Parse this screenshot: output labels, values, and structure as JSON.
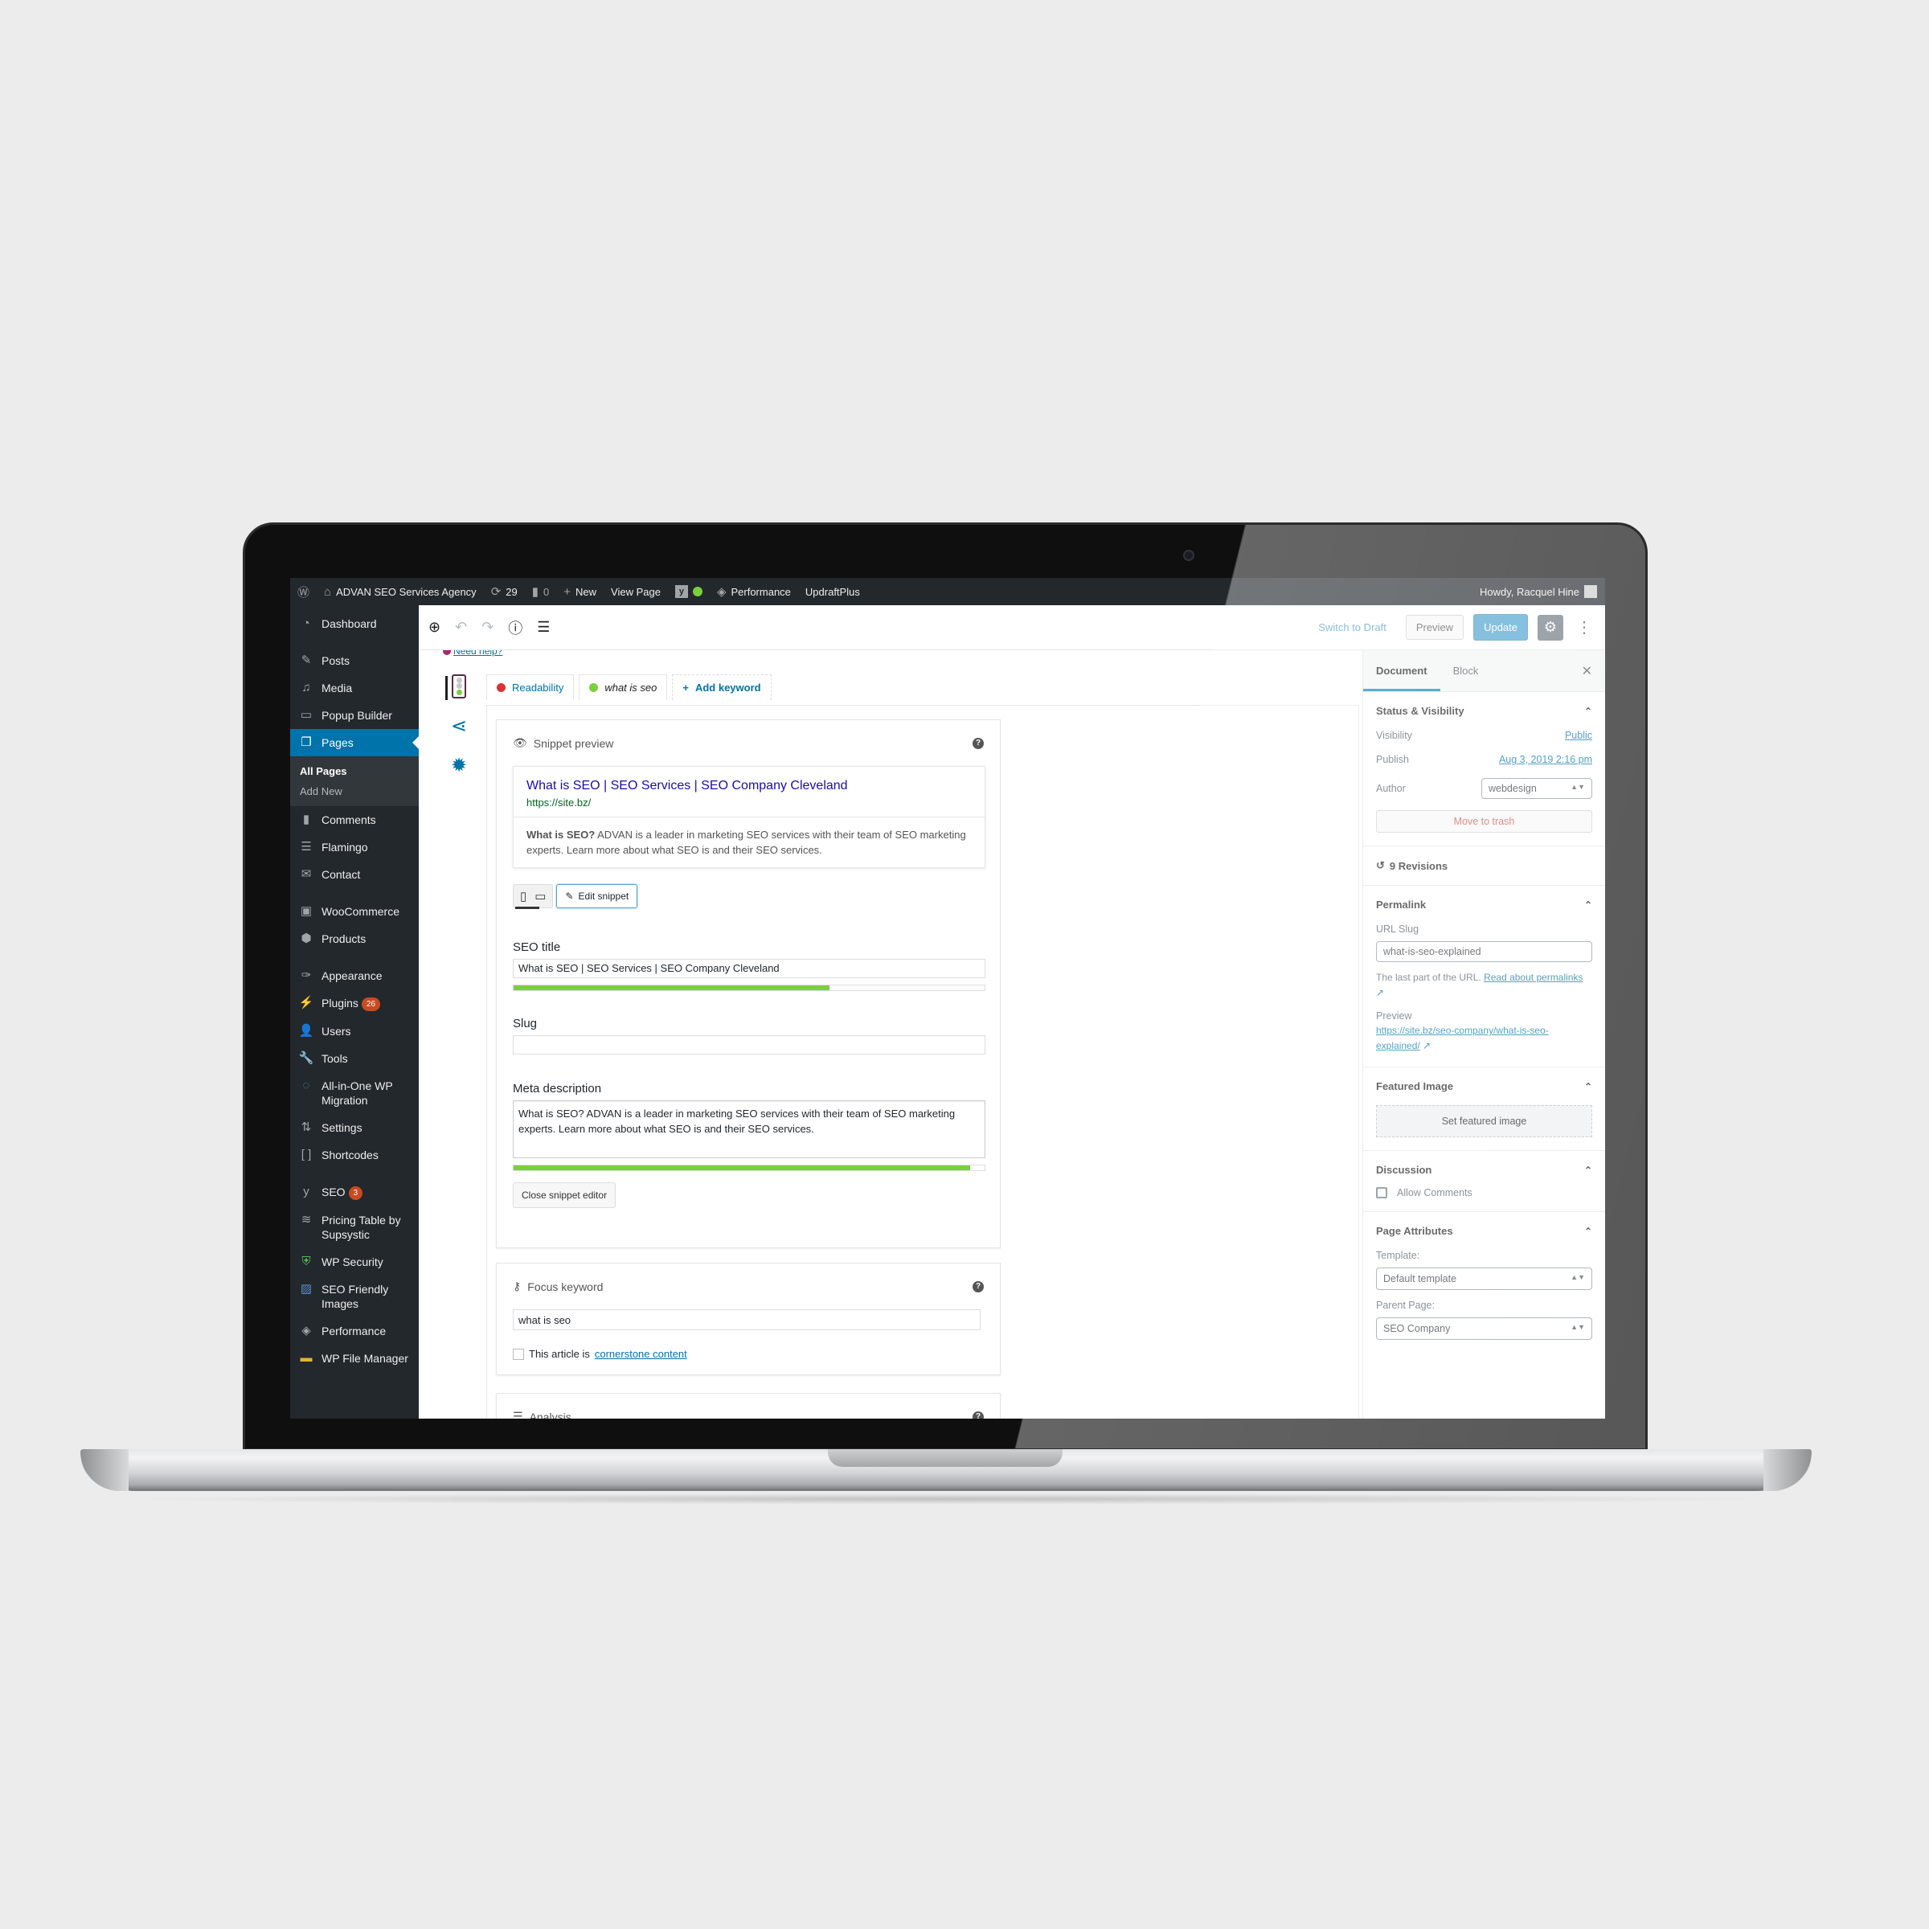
{
  "admin_bar": {
    "wp_logo": "wordpress-icon",
    "site_name": "ADVAN SEO Services Agency",
    "updates_count": "29",
    "comments_count": "0",
    "new_label": "New",
    "view_page_label": "View Page",
    "performance_label": "Performance",
    "updraft_label": "UpdraftPlus",
    "greeting": "Howdy, Racquel Hine"
  },
  "sidebar": {
    "items": [
      {
        "label": "Dashboard",
        "icon": "dashboard-icon"
      },
      {
        "label": "Posts",
        "icon": "pin-icon"
      },
      {
        "label": "Media",
        "icon": "media-icon"
      },
      {
        "label": "Popup Builder",
        "icon": "popup-icon"
      },
      {
        "label": "Pages",
        "icon": "pages-icon",
        "active": true
      },
      {
        "label": "Comments",
        "icon": "comment-icon"
      },
      {
        "label": "Flamingo",
        "icon": "flamingo-icon"
      },
      {
        "label": "Contact",
        "icon": "mail-icon"
      },
      {
        "label": "WooCommerce",
        "icon": "woo-icon"
      },
      {
        "label": "Products",
        "icon": "box-icon"
      },
      {
        "label": "Appearance",
        "icon": "brush-icon"
      },
      {
        "label": "Plugins",
        "icon": "plug-icon",
        "badge": "26"
      },
      {
        "label": "Users",
        "icon": "user-icon"
      },
      {
        "label": "Tools",
        "icon": "wrench-icon"
      },
      {
        "label": "All-in-One WP Migration",
        "icon": "migration-icon"
      },
      {
        "label": "Settings",
        "icon": "sliders-icon"
      },
      {
        "label": "Shortcodes",
        "icon": "brackets-icon"
      },
      {
        "label": "SEO",
        "icon": "yoast-icon",
        "badge": "3"
      },
      {
        "label": "Pricing Table by Supsystic",
        "icon": "stack-icon"
      },
      {
        "label": "WP Security",
        "icon": "shield-icon"
      },
      {
        "label": "SEO Friendly Images",
        "icon": "image-icon"
      },
      {
        "label": "Performance",
        "icon": "performance-icon"
      },
      {
        "label": "WP File Manager",
        "icon": "folder-icon"
      }
    ],
    "submenu": [
      "All Pages",
      "Add New"
    ]
  },
  "editor_header": {
    "switch_to_draft": "Switch to Draft",
    "preview": "Preview",
    "update": "Update"
  },
  "yoast": {
    "need_help": "Need help?",
    "tabs": {
      "readability": "Readability",
      "keyword": "what is seo",
      "add_keyword": "Add keyword"
    },
    "colors": {
      "red": "#dc3232",
      "green": "#7ad03a"
    },
    "snippet_preview": {
      "title": "Snippet preview",
      "seo_title": "What is SEO | SEO Services | SEO Company Cleveland",
      "url": "https://site.bz/",
      "desc_bold": "What is SEO?",
      "desc_rest": " ADVAN is a leader in marketing SEO services with their team of SEO marketing experts. Learn more about what SEO is and their SEO services.",
      "edit_snippet": "Edit snippet"
    },
    "fields": {
      "seo_title_label": "SEO title",
      "seo_title_value": "What is SEO | SEO Services | SEO Company Cleveland",
      "seo_title_progress": 0.67,
      "slug_label": "Slug",
      "slug_value": "",
      "meta_label": "Meta description",
      "meta_value": "What is SEO? ADVAN is a leader in marketing SEO services with their team of SEO marketing experts. Learn more about what SEO is and their SEO services.",
      "meta_progress": 0.97,
      "close_editor": "Close snippet editor"
    },
    "focus_keyword": {
      "title": "Focus keyword",
      "value": "what is seo",
      "cornerstone_prefix": "This article is ",
      "cornerstone_link": "cornerstone content",
      "cornerstone_checked": false
    },
    "analysis_title": "Analysis"
  },
  "settings": {
    "tabs": {
      "document": "Document",
      "block": "Block"
    },
    "status": {
      "title": "Status & Visibility",
      "visibility_label": "Visibility",
      "visibility_value": "Public",
      "publish_label": "Publish",
      "publish_value": "Aug 3, 2019 2:16 pm",
      "author_label": "Author",
      "author_value": "webdesign",
      "trash": "Move to trash"
    },
    "revisions": "9 Revisions",
    "permalink": {
      "title": "Permalink",
      "url_slug_label": "URL Slug",
      "url_slug_value": "what-is-seo-explained",
      "help_prefix": "The last part of the URL. ",
      "help_link": "Read about permalinks",
      "preview_label": "Preview",
      "preview_url": "https://site.bz/seo-company/what-is-seo-explained/"
    },
    "featured_image": {
      "title": "Featured Image",
      "button": "Set featured image"
    },
    "discussion": {
      "title": "Discussion",
      "allow_comments": "Allow Comments",
      "checked": false
    },
    "page_attributes": {
      "title": "Page Attributes",
      "template_label": "Template:",
      "template_value": "Default template",
      "parent_label": "Parent Page:",
      "parent_value": "SEO Company"
    }
  }
}
